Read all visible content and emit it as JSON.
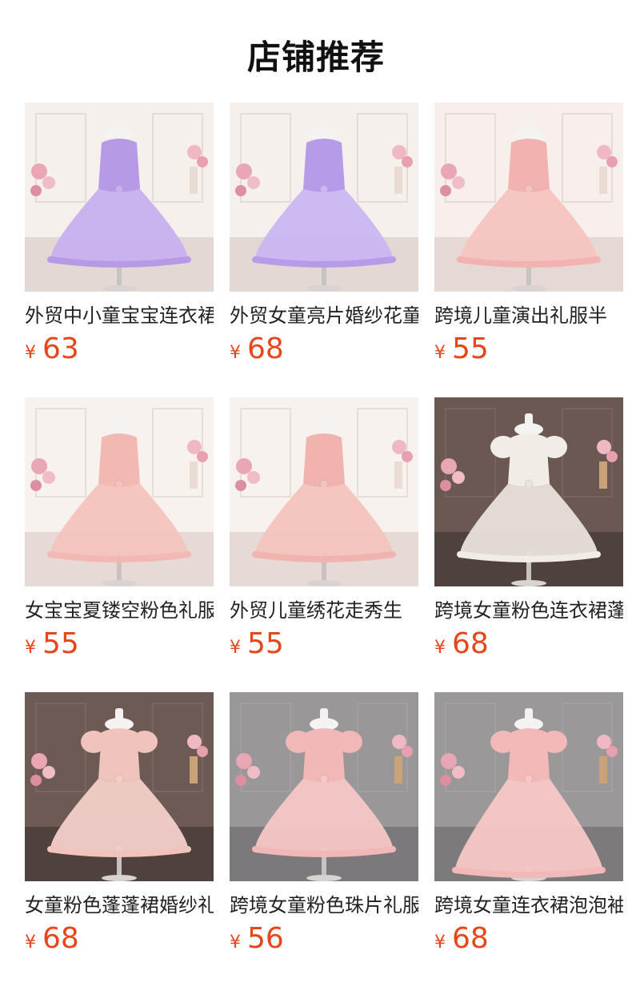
{
  "section_title": "店铺推荐",
  "currency_symbol": "¥",
  "colors": {
    "price": "#e8461a",
    "title": "#111111"
  },
  "products": [
    {
      "name": "外贸中小童宝宝连衣裙",
      "price": "63",
      "image": "lavender-tulle-dress-photo"
    },
    {
      "name": "外贸女童亮片婚纱花童",
      "price": "68",
      "image": "lavender-sequin-dress-photo"
    },
    {
      "name": "跨境儿童演出礼服半",
      "price": "55",
      "image": "pink-flower-dress-photo"
    },
    {
      "name": "女宝宝夏镂空粉色礼服",
      "price": "55",
      "image": "pink-satin-offshoulder-dress-photo"
    },
    {
      "name": "外贸儿童绣花走秀生",
      "price": "55",
      "image": "pink-satin-embroidered-dress-photo"
    },
    {
      "name": "跨境女童粉色连衣裙蓬",
      "price": "68",
      "image": "white-puff-sleeve-dress-photo"
    },
    {
      "name": "女童粉色蓬蓬裙婚纱礼",
      "price": "68",
      "image": "pink-layered-puff-dress-photo"
    },
    {
      "name": "跨境女童粉色珠片礼服",
      "price": "56",
      "image": "pink-bow-tutu-dress-photo"
    },
    {
      "name": "跨境女童连衣裙泡泡袖",
      "price": "68",
      "image": "pink-long-gown-dress-photo"
    }
  ]
}
